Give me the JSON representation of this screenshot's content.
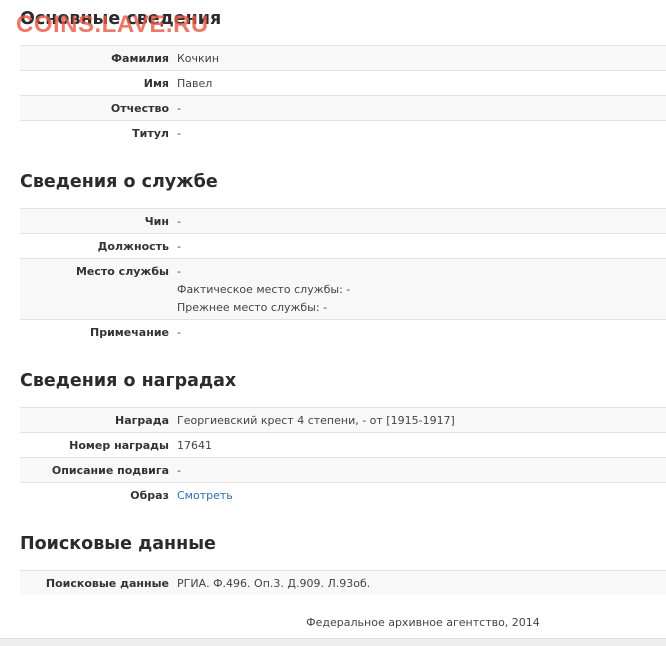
{
  "watermark": "COINS.LAVE.RU",
  "basic": {
    "title": "Основные сведения",
    "rows": [
      {
        "label": "Фамилия",
        "value": "Кочкин"
      },
      {
        "label": "Имя",
        "value": "Павел"
      },
      {
        "label": "Отчество",
        "value": "-"
      },
      {
        "label": "Титул",
        "value": "-"
      }
    ]
  },
  "service": {
    "title": "Сведения о службе",
    "rank": {
      "label": "Чин",
      "value": "-"
    },
    "position": {
      "label": "Должность",
      "value": "-"
    },
    "place": {
      "label": "Место службы",
      "value": "-",
      "actual": "Фактическое место службы: -",
      "former": "Прежнее место службы: -"
    },
    "note": {
      "label": "Примечание",
      "value": "-"
    }
  },
  "awards": {
    "title": "Сведения о наградах",
    "rows": [
      {
        "label": "Награда",
        "value": "Георгиевский крест 4 степени, - от [1915-1917]"
      },
      {
        "label": "Номер награды",
        "value": "17641"
      },
      {
        "label": "Описание подвига",
        "value": "-"
      }
    ],
    "image": {
      "label": "Образ",
      "link": "Смотреть"
    }
  },
  "search": {
    "title": "Поисковые данные",
    "row": {
      "label": "Поисковые данные",
      "value": "РГИА. Ф.496. Оп.3. Д.909. Л.93об."
    }
  },
  "footer": "Федеральное архивное агентство, 2014",
  "colors": {
    "link": "#2a6db0",
    "watermark": "#e85c46",
    "row_shade": "#f8f8f8",
    "border": "#e2e2e2"
  }
}
